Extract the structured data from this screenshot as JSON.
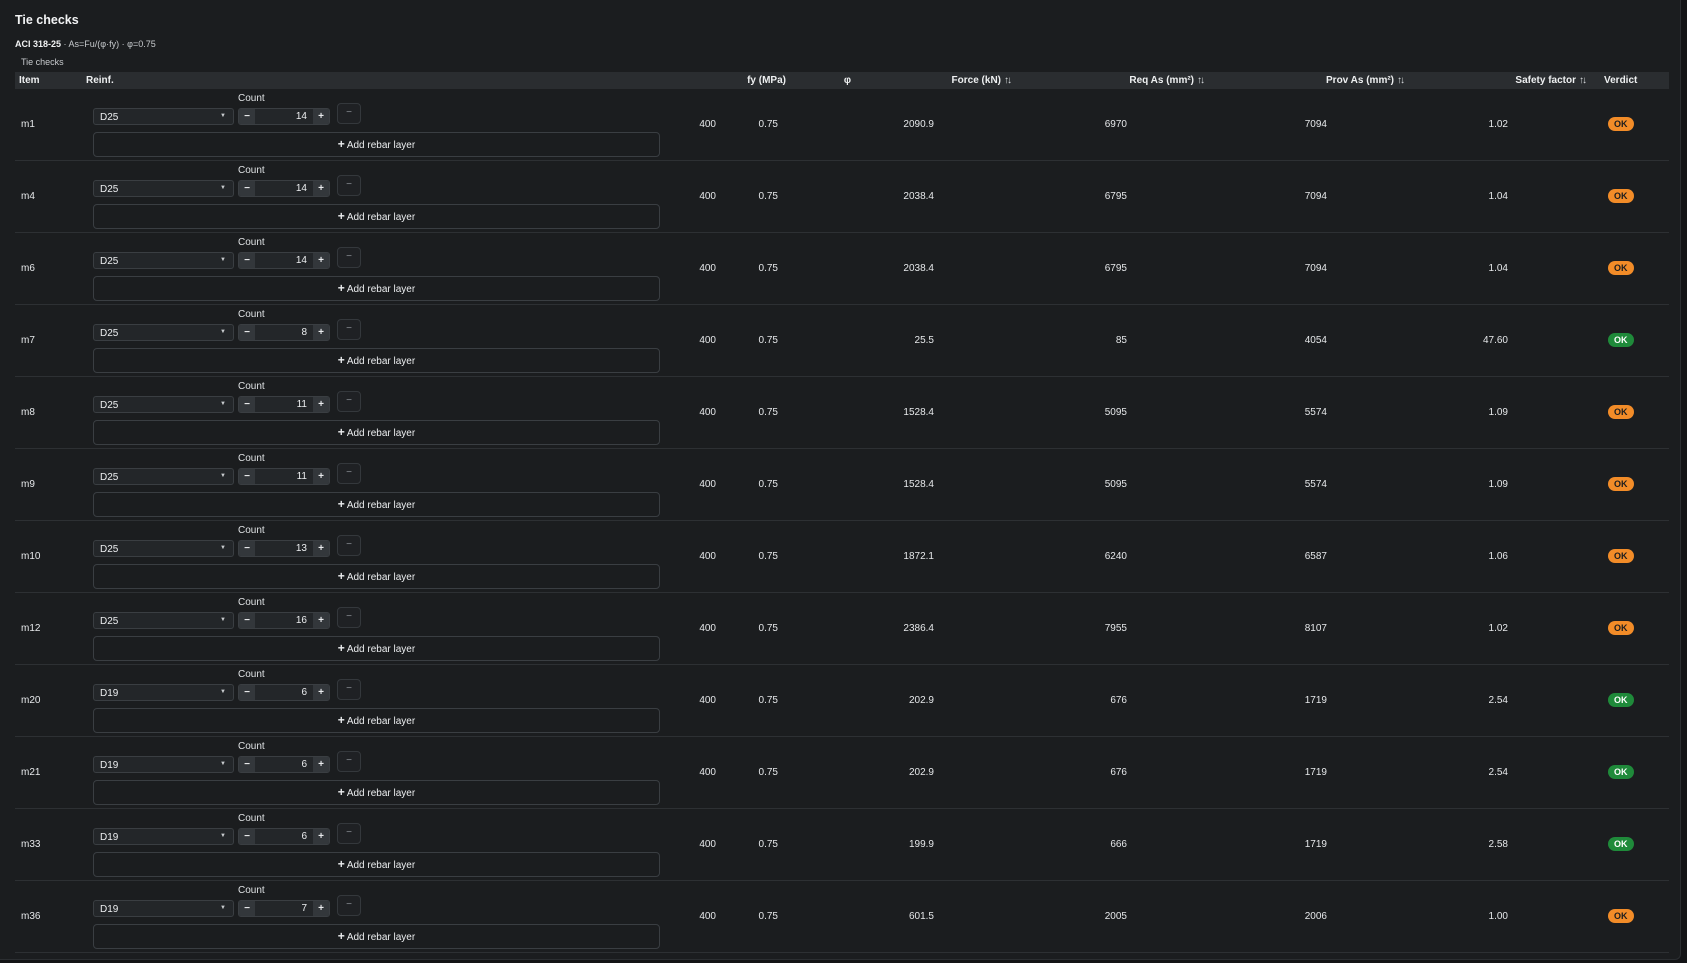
{
  "header": {
    "title": "Tie checks",
    "code": "ACI 318-25",
    "formula": " · As=Fu/(φ·fy) · φ=0.75",
    "caption": "Tie checks"
  },
  "columns": {
    "item": "Item",
    "reinf": "Reinf.",
    "fy": "fy (MPa)",
    "phi": "φ",
    "force": "Force (kN)",
    "req_as": "Req As (mm²)",
    "prov_as": "Prov As (mm²)",
    "safety_factor": "Safety factor",
    "verdict": "Verdict"
  },
  "icons": {
    "sort": "sort-icon",
    "dropdown": "chevron-down-icon",
    "remove": "minus-icon",
    "add": "plus-icon"
  },
  "colors": {
    "ok_warn": "#f28c28",
    "ok_good": "#1f8a3a",
    "background": "#1b1d1f"
  },
  "controls": {
    "count_label": "Count",
    "minus": "−",
    "plus": "+",
    "remove": "−",
    "add_layer": "Add rebar layer",
    "caret": "▼"
  },
  "rows": [
    {
      "item": "m1",
      "bar": "D25",
      "count": "14",
      "fy": "400",
      "phi": "0.75",
      "force": "2090.9",
      "req_as": "6970",
      "prov_as": "7094",
      "sf": "1.02",
      "verdict": "OK",
      "status": "warn"
    },
    {
      "item": "m4",
      "bar": "D25",
      "count": "14",
      "fy": "400",
      "phi": "0.75",
      "force": "2038.4",
      "req_as": "6795",
      "prov_as": "7094",
      "sf": "1.04",
      "verdict": "OK",
      "status": "warn"
    },
    {
      "item": "m6",
      "bar": "D25",
      "count": "14",
      "fy": "400",
      "phi": "0.75",
      "force": "2038.4",
      "req_as": "6795",
      "prov_as": "7094",
      "sf": "1.04",
      "verdict": "OK",
      "status": "warn"
    },
    {
      "item": "m7",
      "bar": "D25",
      "count": "8",
      "fy": "400",
      "phi": "0.75",
      "force": "25.5",
      "req_as": "85",
      "prov_as": "4054",
      "sf": "47.60",
      "verdict": "OK",
      "status": "good"
    },
    {
      "item": "m8",
      "bar": "D25",
      "count": "11",
      "fy": "400",
      "phi": "0.75",
      "force": "1528.4",
      "req_as": "5095",
      "prov_as": "5574",
      "sf": "1.09",
      "verdict": "OK",
      "status": "warn"
    },
    {
      "item": "m9",
      "bar": "D25",
      "count": "11",
      "fy": "400",
      "phi": "0.75",
      "force": "1528.4",
      "req_as": "5095",
      "prov_as": "5574",
      "sf": "1.09",
      "verdict": "OK",
      "status": "warn"
    },
    {
      "item": "m10",
      "bar": "D25",
      "count": "13",
      "fy": "400",
      "phi": "0.75",
      "force": "1872.1",
      "req_as": "6240",
      "prov_as": "6587",
      "sf": "1.06",
      "verdict": "OK",
      "status": "warn"
    },
    {
      "item": "m12",
      "bar": "D25",
      "count": "16",
      "fy": "400",
      "phi": "0.75",
      "force": "2386.4",
      "req_as": "7955",
      "prov_as": "8107",
      "sf": "1.02",
      "verdict": "OK",
      "status": "warn"
    },
    {
      "item": "m20",
      "bar": "D19",
      "count": "6",
      "fy": "400",
      "phi": "0.75",
      "force": "202.9",
      "req_as": "676",
      "prov_as": "1719",
      "sf": "2.54",
      "verdict": "OK",
      "status": "good"
    },
    {
      "item": "m21",
      "bar": "D19",
      "count": "6",
      "fy": "400",
      "phi": "0.75",
      "force": "202.9",
      "req_as": "676",
      "prov_as": "1719",
      "sf": "2.54",
      "verdict": "OK",
      "status": "good"
    },
    {
      "item": "m33",
      "bar": "D19",
      "count": "6",
      "fy": "400",
      "phi": "0.75",
      "force": "199.9",
      "req_as": "666",
      "prov_as": "1719",
      "sf": "2.58",
      "verdict": "OK",
      "status": "good"
    },
    {
      "item": "m36",
      "bar": "D19",
      "count": "7",
      "fy": "400",
      "phi": "0.75",
      "force": "601.5",
      "req_as": "2005",
      "prov_as": "2006",
      "sf": "1.00",
      "verdict": "OK",
      "status": "warn"
    }
  ]
}
